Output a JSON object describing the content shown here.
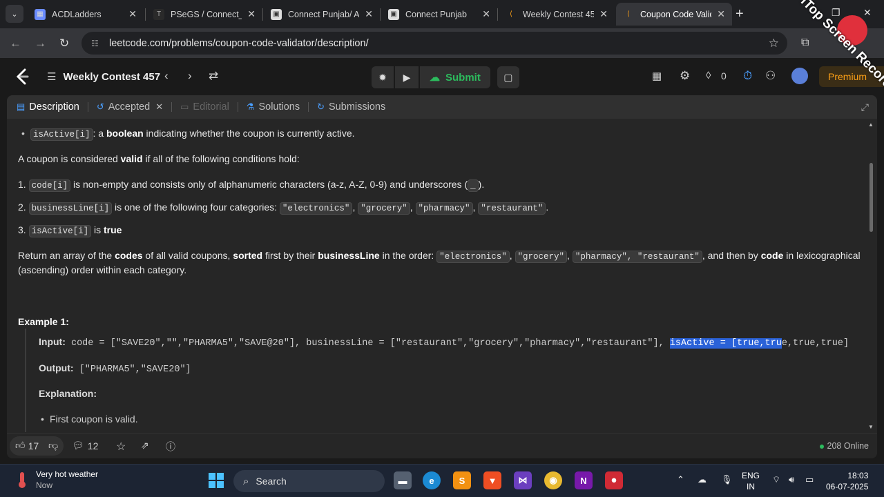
{
  "browser": {
    "tabs": [
      {
        "title": "ACDLadders",
        "favicon_color": "#6b8cff"
      },
      {
        "title": "PSeGS / Connect_I",
        "favicon_color": "#2a2a2a"
      },
      {
        "title": "Connect Punjab/ A",
        "favicon_color": "#dddddd"
      },
      {
        "title": "Connect Punjab",
        "favicon_color": "#dddddd"
      },
      {
        "title": "Weekly Contest 45",
        "favicon_color": "#ffa116"
      },
      {
        "title": "Coupon Code Valid",
        "favicon_color": "#ffa116"
      }
    ],
    "url": "leetcode.com/problems/coupon-code-validator/description/"
  },
  "header": {
    "contest_title": "Weekly Contest 457",
    "submit_label": "Submit",
    "points": "0",
    "premium_label": "Premium"
  },
  "panel_tabs": {
    "description": "Description",
    "accepted": "Accepted",
    "editorial": "Editorial",
    "solutions": "Solutions",
    "submissions": "Submissions"
  },
  "content": {
    "l1_code": "isActive[i]",
    "l1_text_a": ": a ",
    "l1_bold": "boolean",
    "l1_text_b": " indicating whether the coupon is currently active.",
    "l2_a": "A coupon is considered ",
    "l2_bold": "valid",
    "l2_b": " if all of the following conditions hold:",
    "c1_num": "1.",
    "c1_code": "code[i]",
    "c1_text": " is non-empty and consists only of alphanumeric characters (a-z, A-Z, 0-9) and underscores (",
    "c1_code2": "_",
    "c1_end": ").",
    "c2_num": "2.",
    "c2_code": "businessLine[i]",
    "c2_text": " is one of the following four categories: ",
    "c2_cats": [
      "\"electronics\"",
      "\"grocery\"",
      "\"pharmacy\"",
      "\"restaurant\""
    ],
    "c3_num": "3.",
    "c3_code": "isActive[i]",
    "c3_text": " is ",
    "c3_bold": "true",
    "ret_a": "Return an array of the ",
    "ret_b1": "codes",
    "ret_c": " of all valid coupons, ",
    "ret_b2": "sorted",
    "ret_d": " first by their ",
    "ret_b3": "businessLine",
    "ret_e": " in the order: ",
    "ret_code1": "\"electronics\"",
    "ret_code2": "\"grocery\"",
    "ret_code3": "\"pharmacy\", \"restaurant\"",
    "ret_f": ", and then by ",
    "ret_b4": "code",
    "ret_g": " in lexicographical",
    "ret_h": "(ascending) order within each category.",
    "example_title": "Example 1:",
    "input_label": "Input:",
    "input_val": " code = [\"SAVE20\",\"\",\"PHARMA5\",\"SAVE@20\"], businessLine = [\"restaurant\",\"grocery\",\"pharmacy\",\"restaurant\"], ",
    "input_selected": "isActive = [true,tru",
    "input_rest": "e,true,true]",
    "output_label": "Output:",
    "output_val": " [\"PHARMA5\",\"SAVE20\"]",
    "explanation_label": "Explanation:",
    "exp_item": "First coupon is valid."
  },
  "footer": {
    "likes": "17",
    "comments": "12",
    "online": "208 Online"
  },
  "taskbar": {
    "weather_title": "Very hot weather",
    "weather_sub": "Now",
    "search_placeholder": "Search",
    "lang_top": "ENG",
    "lang_bottom": "IN",
    "time": "18:03",
    "date": "06-07-2025"
  },
  "watermark": "iTop Screen Recorder"
}
